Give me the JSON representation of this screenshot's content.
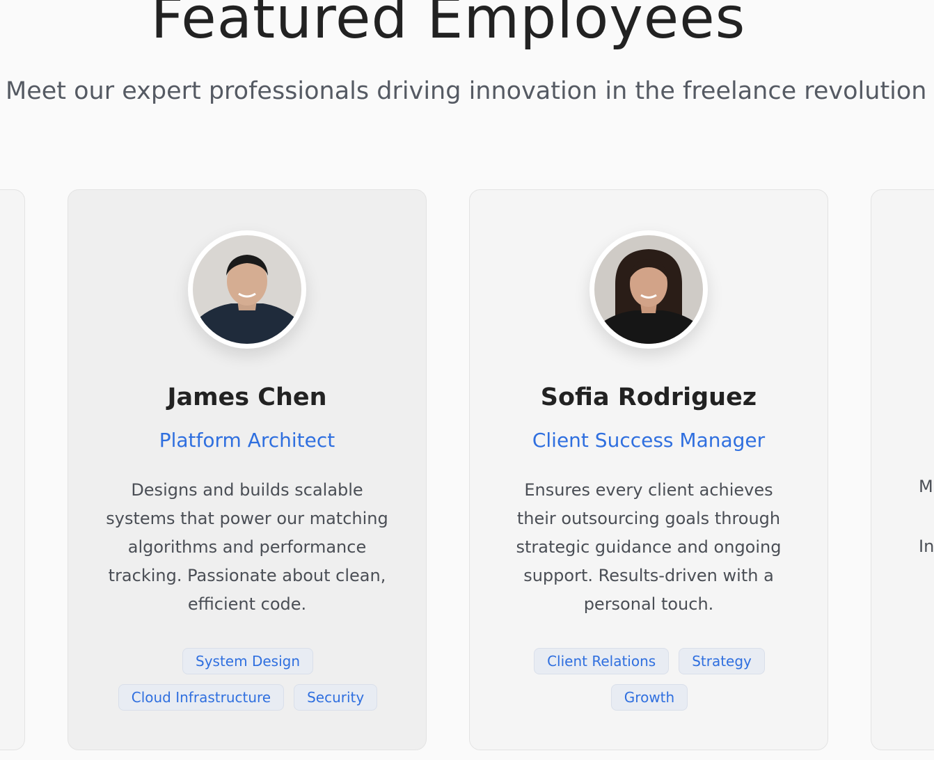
{
  "section": {
    "title": "Featured Employees",
    "subtitle": "Meet our expert professionals driving innovation in the freelance revolution"
  },
  "employees": [
    {
      "name": "James Chen",
      "role": "Platform Architect",
      "bio": "Designs and builds scalable systems that power our matching algorithms and performance tracking. Passionate about clean, efficient code.",
      "tags": [
        "System Design",
        "Cloud Infrastructure",
        "Security"
      ]
    },
    {
      "name": "Sofia Rodriguez",
      "role": "Client Success Manager",
      "bio": "Ensures every client achieves their outsourcing goals through strategic guidance and ongoing support. Results-driven with a personal touch.",
      "tags": [
        "Client Relations",
        "Strategy",
        "Growth"
      ]
    }
  ],
  "partial_card_right": {
    "line1": "M",
    "line2": "In"
  },
  "colors": {
    "accent": "#2f6fdf",
    "tag_bg": "#e8ecf3",
    "page_bg": "#fafafa"
  }
}
